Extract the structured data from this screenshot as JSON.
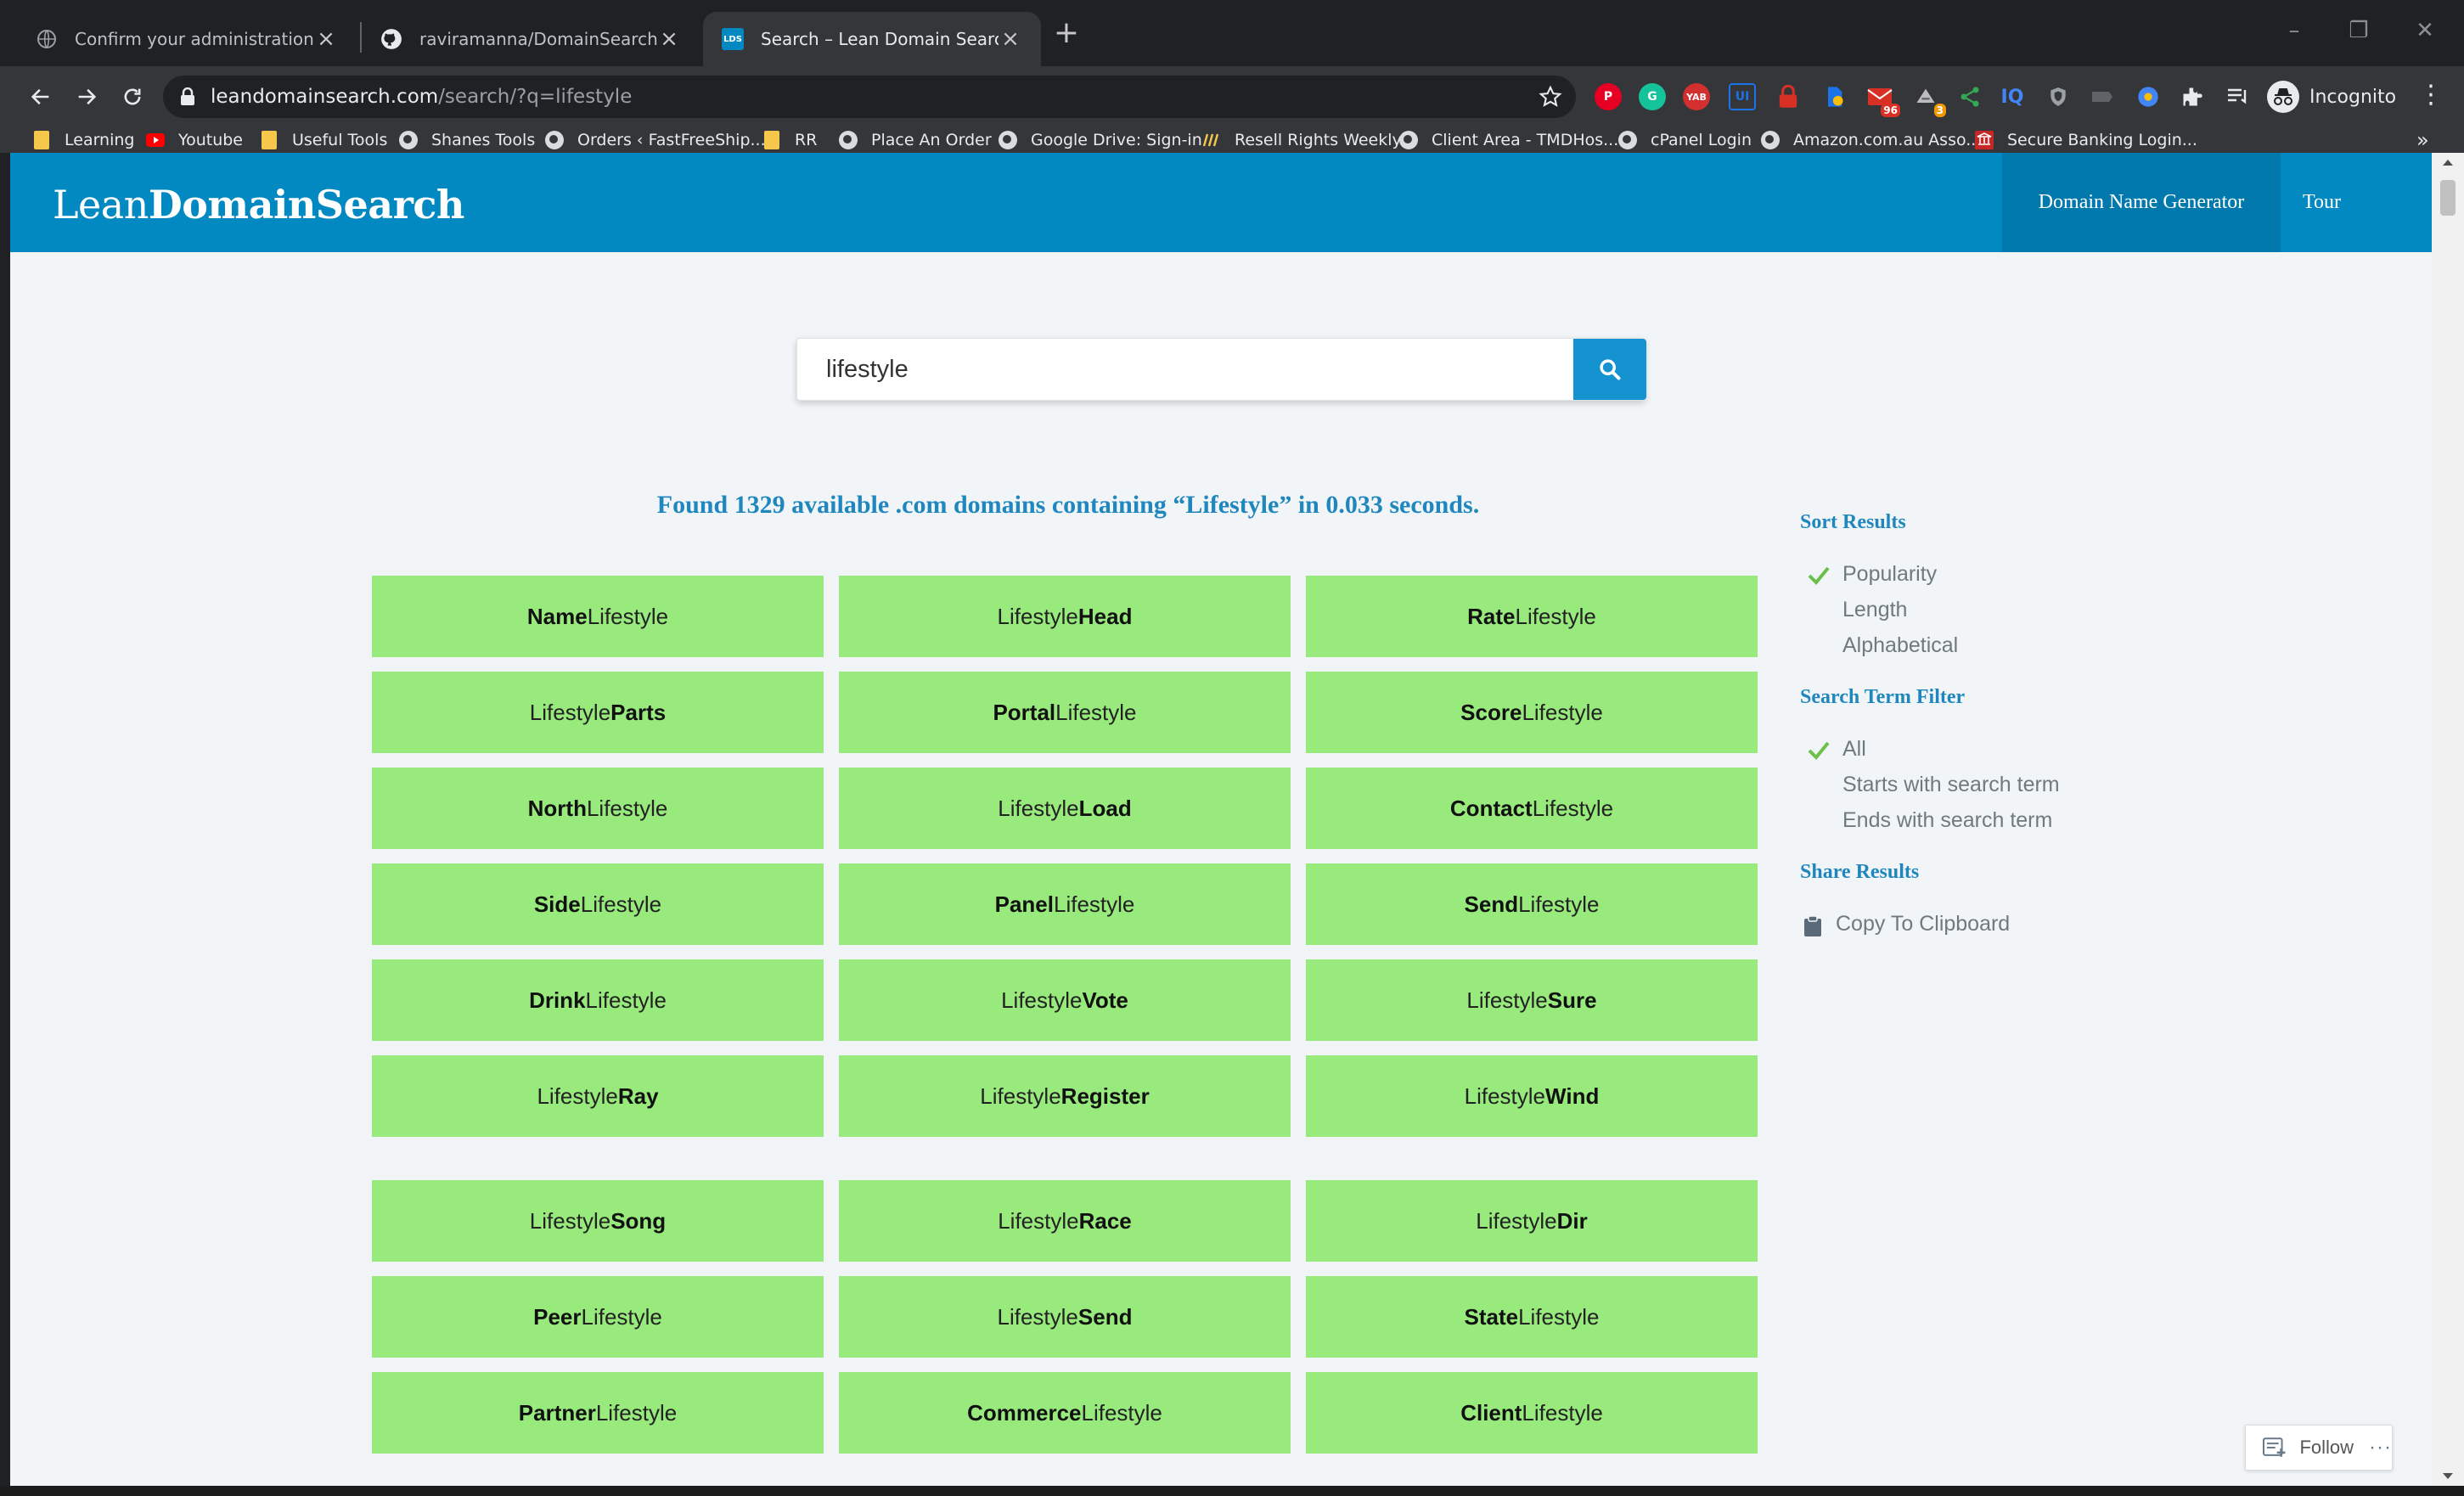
{
  "browser": {
    "tabs": [
      {
        "title": "Confirm your administration email ·",
        "active": false
      },
      {
        "title": "raviramanna/DomainSearcher",
        "active": false
      },
      {
        "title": "Search – Lean Domain Search",
        "active": true,
        "favicon_text": "LDS"
      }
    ],
    "address": {
      "host": "leandomainsearch.com",
      "path": "/search/?q=lifestyle"
    },
    "extension_badges": {
      "mail_count": "96",
      "count2": "3"
    },
    "profile_label": "Incognito",
    "bookmarks": [
      {
        "label": "Learning",
        "icon": "folder-icon"
      },
      {
        "label": "Youtube",
        "icon": "youtube-icon"
      },
      {
        "label": "Useful Tools",
        "icon": "folder-icon"
      },
      {
        "label": "Shanes Tools",
        "icon": "globe-icon"
      },
      {
        "label": "Orders ‹ FastFreeShip...",
        "icon": "globe-icon"
      },
      {
        "label": "RR",
        "icon": "folder-icon"
      },
      {
        "label": "Place An Order",
        "icon": "globe-icon"
      },
      {
        "label": "Google Drive: Sign-in",
        "icon": "globe-icon"
      },
      {
        "label": "Resell Rights Weekly",
        "icon": "rrw-icon"
      },
      {
        "label": "Client Area - TMDHos...",
        "icon": "globe-icon"
      },
      {
        "label": "cPanel Login",
        "icon": "globe-icon"
      },
      {
        "label": "Amazon.com.au Asso...",
        "icon": "globe-icon"
      },
      {
        "label": "Secure Banking Login...",
        "icon": "bank-icon"
      }
    ],
    "bookmarks_overflow": "»"
  },
  "site": {
    "logo_light": "Lean",
    "logo_bold": "DomainSearch",
    "nav": {
      "generator": "Domain Name Generator",
      "tour": "Tour"
    }
  },
  "search": {
    "query": "lifestyle"
  },
  "summary": "Found 1329 available .com domains containing “Lifestyle” in 0.033 seconds.",
  "results": [
    {
      "bold": "Name",
      "rest": "Lifestyle",
      "bold_first": true
    },
    {
      "bold": "Head",
      "rest": "Lifestyle",
      "bold_first": false
    },
    {
      "bold": "Rate",
      "rest": "Lifestyle",
      "bold_first": true
    },
    {
      "bold": "Parts",
      "rest": "Lifestyle",
      "bold_first": false
    },
    {
      "bold": "Portal",
      "rest": "Lifestyle",
      "bold_first": true
    },
    {
      "bold": "Score",
      "rest": "Lifestyle",
      "bold_first": true
    },
    {
      "bold": "North",
      "rest": "Lifestyle",
      "bold_first": true
    },
    {
      "bold": "Load",
      "rest": "Lifestyle",
      "bold_first": false
    },
    {
      "bold": "Contact",
      "rest": "Lifestyle",
      "bold_first": true
    },
    {
      "bold": "Side",
      "rest": "Lifestyle",
      "bold_first": true
    },
    {
      "bold": "Panel",
      "rest": "Lifestyle",
      "bold_first": true
    },
    {
      "bold": "Send",
      "rest": "Lifestyle",
      "bold_first": true
    },
    {
      "bold": "Drink",
      "rest": "Lifestyle",
      "bold_first": true
    },
    {
      "bold": "Vote",
      "rest": "Lifestyle",
      "bold_first": false
    },
    {
      "bold": "Sure",
      "rest": "Lifestyle",
      "bold_first": false
    },
    {
      "bold": "Ray",
      "rest": "Lifestyle",
      "bold_first": false
    },
    {
      "bold": "Register",
      "rest": "Lifestyle",
      "bold_first": false
    },
    {
      "bold": "Wind",
      "rest": "Lifestyle",
      "bold_first": false
    },
    {
      "bold": "Song",
      "rest": "Lifestyle",
      "bold_first": false
    },
    {
      "bold": "Race",
      "rest": "Lifestyle",
      "bold_first": false
    },
    {
      "bold": "Dir",
      "rest": "Lifestyle",
      "bold_first": false
    },
    {
      "bold": "Peer",
      "rest": "Lifestyle",
      "bold_first": true
    },
    {
      "bold": "Send",
      "rest": "Lifestyle",
      "bold_first": false
    },
    {
      "bold": "State",
      "rest": "Lifestyle",
      "bold_first": true
    },
    {
      "bold": "Partner",
      "rest": "Lifestyle",
      "bold_first": true
    },
    {
      "bold": "Commerce",
      "rest": "Lifestyle",
      "bold_first": true
    },
    {
      "bold": "Client",
      "rest": "Lifestyle",
      "bold_first": true
    }
  ],
  "sidebar": {
    "sort_heading": "Sort Results",
    "sort_options": [
      {
        "label": "Popularity",
        "checked": true
      },
      {
        "label": "Length",
        "checked": false
      },
      {
        "label": "Alphabetical",
        "checked": false
      }
    ],
    "filter_heading": "Search Term Filter",
    "filter_options": [
      {
        "label": "All",
        "checked": true
      },
      {
        "label": "Starts with search term",
        "checked": false
      },
      {
        "label": "Ends with search term",
        "checked": false
      }
    ],
    "share_heading": "Share Results",
    "copy_label": "Copy To Clipboard"
  },
  "follow": {
    "label": "Follow",
    "more": "···"
  },
  "colors": {
    "brand": "#0389c2",
    "card": "#98ea7d",
    "accent_text": "#1f87bd",
    "check": "#6cc04a"
  }
}
